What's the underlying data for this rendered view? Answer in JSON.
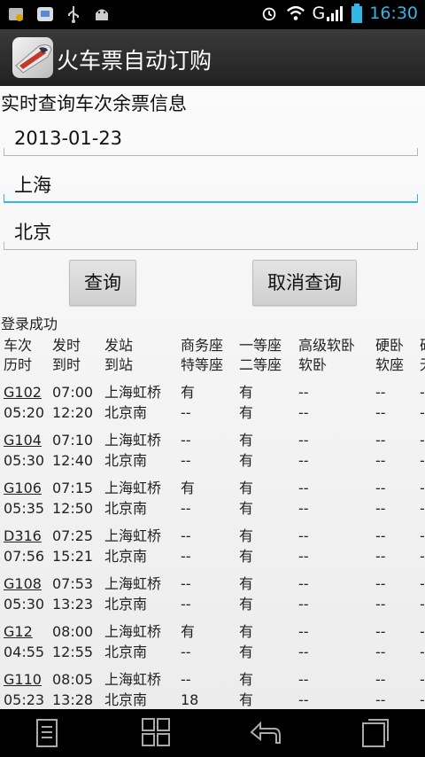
{
  "status_bar": {
    "time": "16:30",
    "network": "G",
    "icons": [
      "photo-icon",
      "message-icon",
      "usb-icon",
      "android-debug-icon",
      "alarm-icon",
      "wifi-icon",
      "signal-icon",
      "battery-icon"
    ]
  },
  "app": {
    "title": "火车票自动订购",
    "icon": "train-logo-icon"
  },
  "section_title": "实时查询车次余票信息",
  "form": {
    "date": "2013-01-23",
    "from": "上海",
    "to": "北京",
    "query_button": "查询",
    "cancel_button": "取消查询"
  },
  "status_message": "登录成功",
  "table": {
    "headers": [
      [
        "车次",
        "历时"
      ],
      [
        "发时",
        "到时"
      ],
      [
        "发站",
        "到站"
      ],
      [
        "商务座",
        "特等座"
      ],
      [
        "一等座",
        "二等座"
      ],
      [
        "高级软卧",
        "软卧"
      ],
      [
        "硬卧",
        "软座"
      ],
      [
        "硬",
        "无"
      ]
    ],
    "rows": [
      {
        "train": "G102",
        "duration": "05:20",
        "depart": "07:00",
        "arrive": "12:20",
        "from": "上海虹桥",
        "to": "北京南",
        "business": "有",
        "special": "--",
        "first": "有",
        "second": "有",
        "sr_deluxe": "--",
        "soft_sleeper": "--",
        "hard_sleeper": "--",
        "soft_seat": "--",
        "hard_seat": "-",
        "no_seat": "-"
      },
      {
        "train": "G104",
        "duration": "05:30",
        "depart": "07:10",
        "arrive": "12:40",
        "from": "上海虹桥",
        "to": "北京南",
        "business": "--",
        "special": "--",
        "first": "有",
        "second": "有",
        "sr_deluxe": "--",
        "soft_sleeper": "--",
        "hard_sleeper": "--",
        "soft_seat": "--",
        "hard_seat": "-",
        "no_seat": "-"
      },
      {
        "train": "G106",
        "duration": "05:35",
        "depart": "07:15",
        "arrive": "12:50",
        "from": "上海虹桥",
        "to": "北京南",
        "business": "有",
        "special": "--",
        "first": "有",
        "second": "有",
        "sr_deluxe": "--",
        "soft_sleeper": "--",
        "hard_sleeper": "--",
        "soft_seat": "--",
        "hard_seat": "-",
        "no_seat": "-"
      },
      {
        "train": "D316",
        "duration": "07:56",
        "depart": "07:25",
        "arrive": "15:21",
        "from": "上海虹桥",
        "to": "北京南",
        "business": "--",
        "special": "--",
        "first": "有",
        "second": "有",
        "sr_deluxe": "--",
        "soft_sleeper": "--",
        "hard_sleeper": "--",
        "soft_seat": "--",
        "hard_seat": "-",
        "no_seat": "-"
      },
      {
        "train": "G108",
        "duration": "05:30",
        "depart": "07:53",
        "arrive": "13:23",
        "from": "上海虹桥",
        "to": "北京南",
        "business": "--",
        "special": "--",
        "first": "有",
        "second": "有",
        "sr_deluxe": "--",
        "soft_sleeper": "--",
        "hard_sleeper": "--",
        "soft_seat": "--",
        "hard_seat": "-",
        "no_seat": "-"
      },
      {
        "train": "G12",
        "duration": "04:55",
        "depart": "08:00",
        "arrive": "12:55",
        "from": "上海虹桥",
        "to": "北京南",
        "business": "有",
        "special": "--",
        "first": "有",
        "second": "有",
        "sr_deluxe": "--",
        "soft_sleeper": "--",
        "hard_sleeper": "--",
        "soft_seat": "--",
        "hard_seat": "-",
        "no_seat": "-"
      },
      {
        "train": "G110",
        "duration": "05:23",
        "depart": "08:05",
        "arrive": "13:28",
        "from": "上海虹桥",
        "to": "北京南",
        "business": "--",
        "special": "18",
        "first": "有",
        "second": "有",
        "sr_deluxe": "--",
        "soft_sleeper": "--",
        "hard_sleeper": "--",
        "soft_seat": "--",
        "hard_seat": "-",
        "no_seat": "-"
      }
    ]
  },
  "nav_bar": {
    "icons": [
      "menu-icon",
      "recent-grid-icon",
      "back-icon",
      "recent-apps-icon"
    ]
  }
}
